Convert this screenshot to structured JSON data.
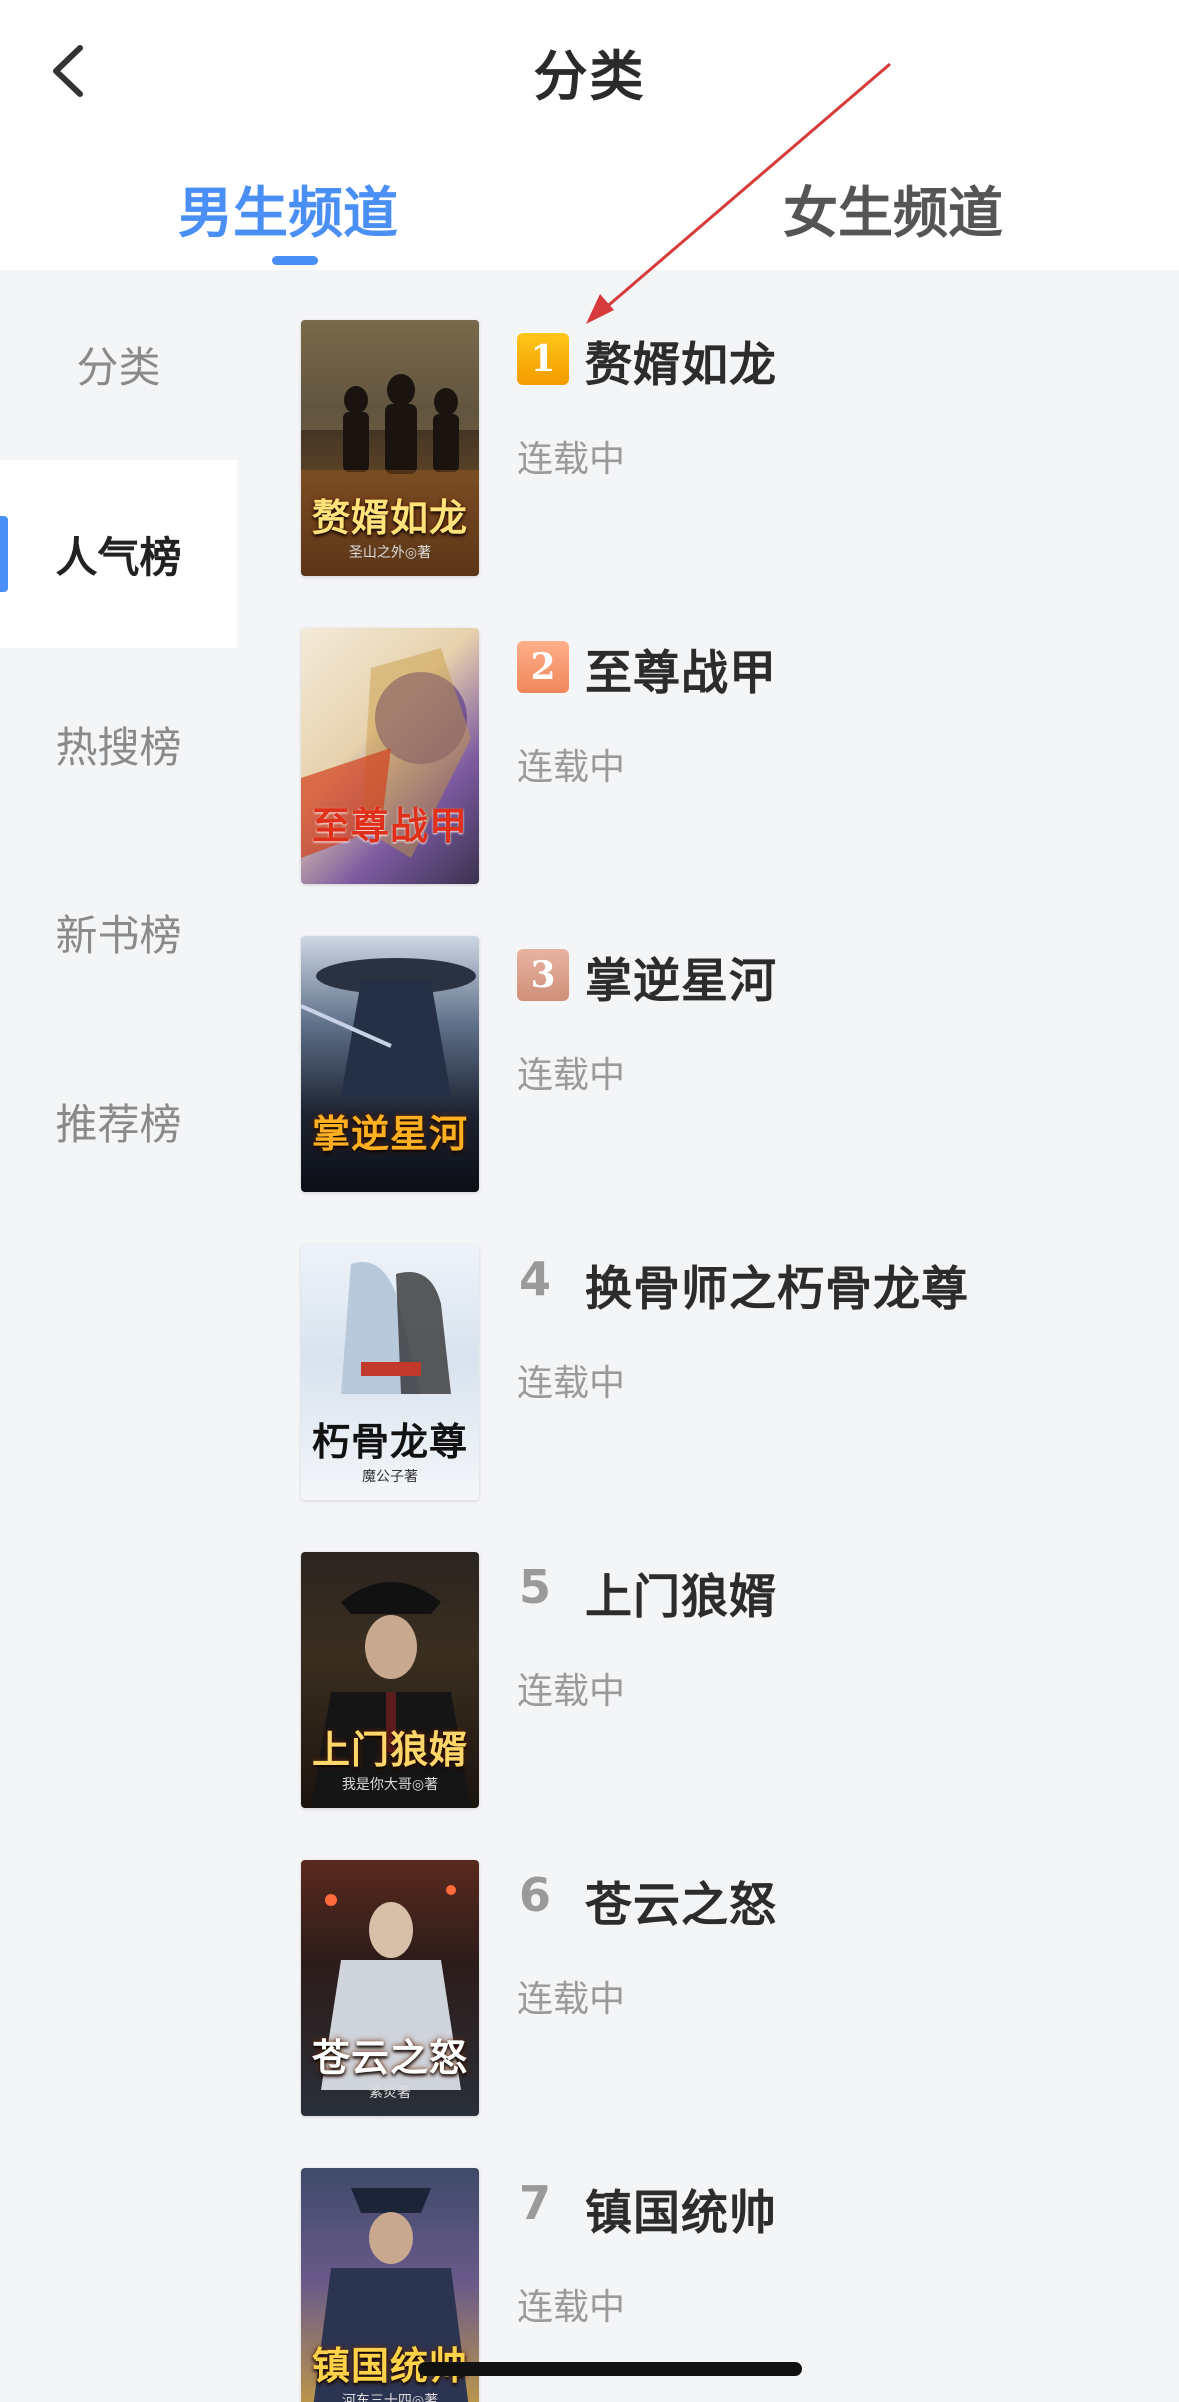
{
  "header": {
    "title": "分类",
    "back_icon": "chevron-left-icon"
  },
  "tabs": {
    "male": "男生频道",
    "female": "女生频道",
    "active": "male"
  },
  "rail": {
    "items": [
      {
        "label": "分类",
        "active": false
      },
      {
        "label": "人气榜",
        "active": true
      },
      {
        "label": "热搜榜",
        "active": false
      },
      {
        "label": "新书榜",
        "active": false
      },
      {
        "label": "推荐榜",
        "active": false
      }
    ]
  },
  "books": [
    {
      "rank": "1",
      "title": "赘婿如龙",
      "status": "连载中",
      "cover_text": "赘婿如龙",
      "cover_author": "圣山之外◎著"
    },
    {
      "rank": "2",
      "title": "至尊战甲",
      "status": "连载中",
      "cover_text": "至尊战甲",
      "cover_author": ""
    },
    {
      "rank": "3",
      "title": "掌逆星河",
      "status": "连载中",
      "cover_text": "掌逆星河",
      "cover_author": ""
    },
    {
      "rank": "4",
      "title": "换骨师之朽骨龙尊",
      "status": "连载中",
      "cover_text": "朽骨龙尊",
      "cover_author": "魔公子著"
    },
    {
      "rank": "5",
      "title": "上门狼婿",
      "status": "连载中",
      "cover_text": "上门狼婿",
      "cover_author": "我是你大哥◎著"
    },
    {
      "rank": "6",
      "title": "苍云之怒",
      "status": "连载中",
      "cover_text": "苍云之怒",
      "cover_author": "紫炎著"
    },
    {
      "rank": "7",
      "title": "镇国统帅",
      "status": "连载中",
      "cover_text": "镇国统帅",
      "cover_author": "河东三十四◎著"
    }
  ],
  "colors": {
    "accent": "#4a8ff5",
    "rank1": "#f5a800",
    "rank2": "#f5996b",
    "rank3": "#d9a08c",
    "annotation_arrow": "#d63a3a"
  }
}
